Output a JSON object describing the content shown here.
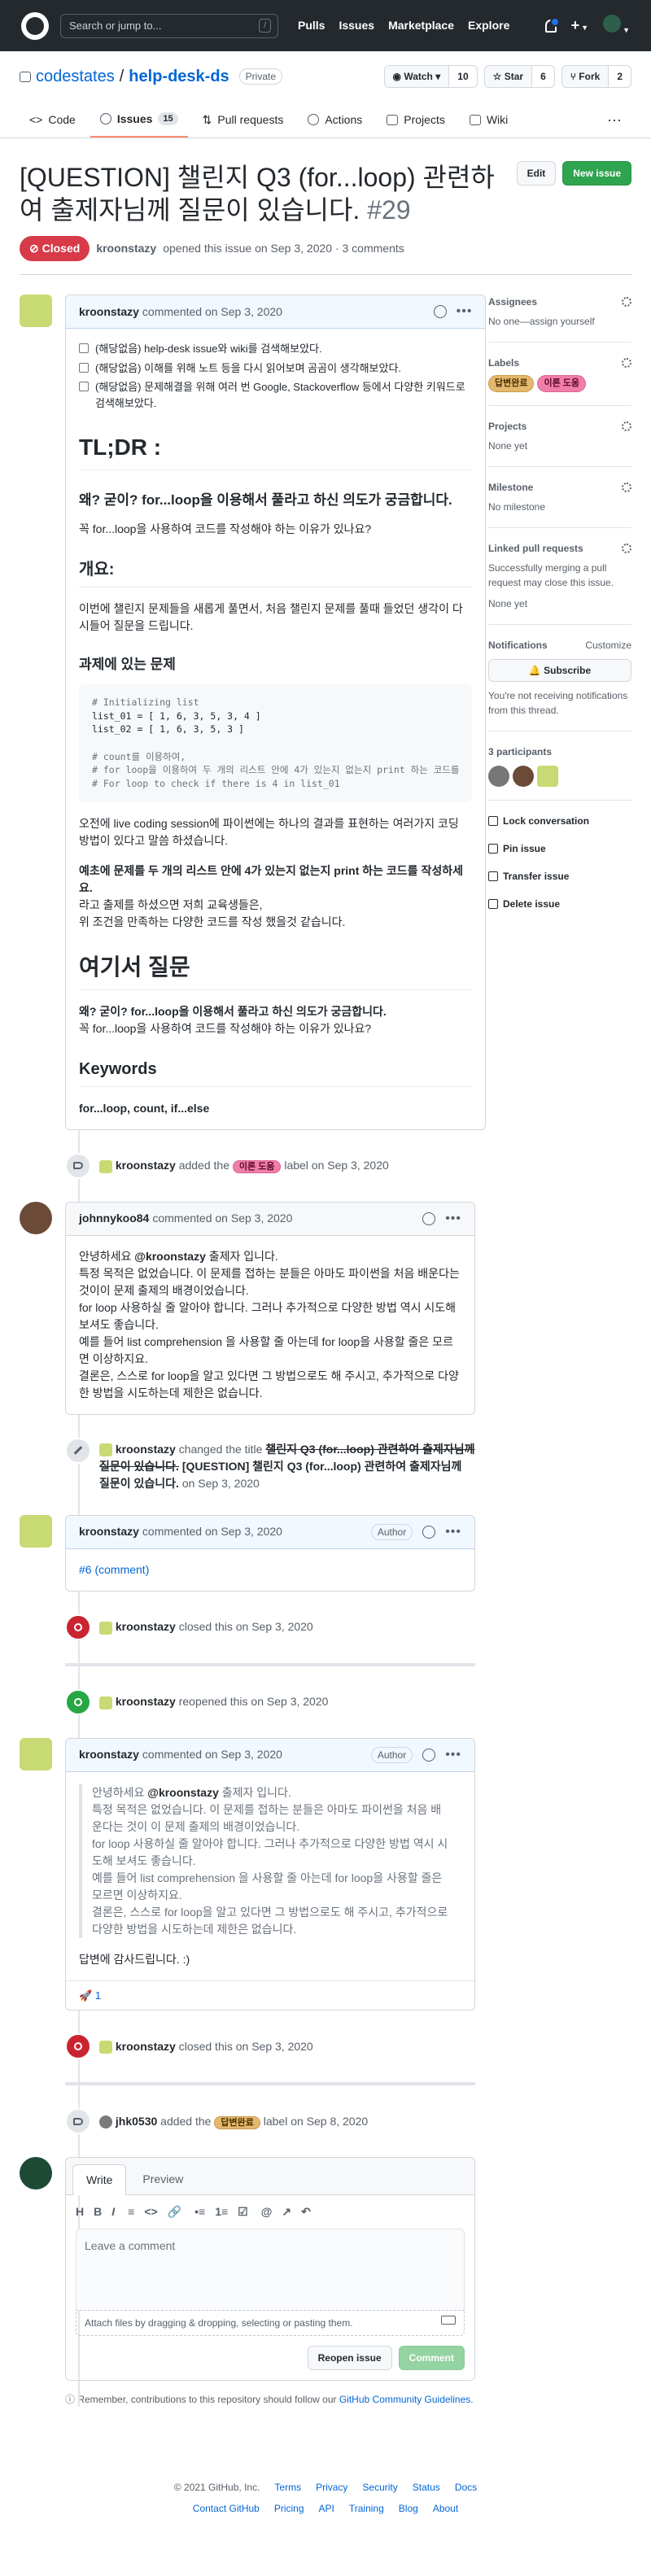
{
  "header": {
    "search_placeholder": "Search or jump to...",
    "slash_key": "/",
    "nav": [
      "Pulls",
      "Issues",
      "Marketplace",
      "Explore"
    ],
    "plus": "+"
  },
  "repo": {
    "owner": "codestates",
    "separator": "/",
    "name": "help-desk-ds",
    "visibility": "Private",
    "watch_label": "Watch",
    "watch_count": "10",
    "star_label": "Star",
    "star_count": "6",
    "fork_label": "Fork",
    "fork_count": "2",
    "tabs": [
      {
        "label": "Code"
      },
      {
        "label": "Issues",
        "count": "15"
      },
      {
        "label": "Pull requests"
      },
      {
        "label": "Actions"
      },
      {
        "label": "Projects"
      },
      {
        "label": "Wiki"
      }
    ],
    "more": "···"
  },
  "issue": {
    "title": "[QUESTION] 챌린지 Q3 (for...loop) 관련하여 출제자님께 질문이 있습니다.",
    "number": "#29",
    "edit_label": "Edit",
    "new_issue_label": "New issue",
    "state": "Closed",
    "author": "kroonstazy",
    "meta": "opened this issue on Sep 3, 2020 · 3 comments"
  },
  "comment1": {
    "author": "kroonstazy",
    "meta": "commented on Sep 3, 2020",
    "tasks": [
      "(해당없음) help-desk issue와 wiki를 검색해보았다.",
      "(해당없음) 이해를 위해 노트 등을 다시 읽어보며 곰곰이 생각해보았다.",
      "(해당없음) 문제해결을 위해 여러 번 Google, Stackoverflow 등에서 다양한 키워드로 검색해보았다."
    ],
    "h_tldr": "TL;DR :",
    "tldr_q": "왜? 굳이? for...loop을 이용해서 풀라고 하신 의도가 궁금합니다.",
    "tldr_p": "꼭 for...loop을 사용하여 코드를 작성해야 하는 이유가 있나요?",
    "h_overview": "개요:",
    "overview_p": "이번에 챌린지 문제들을 새롭게 풀면서, 처음 챌린지 문제를 풀때 들었던 생각이 다시들어 질문을 드립니다.",
    "h_problem": "과제에 있는 문제",
    "code": {
      "c1": "# Initializing list",
      "l1": "list_01 = [ 1, 6, 3, 5, 3, 4 ]",
      "l2": "list_02 = [ 1, 6, 3, 5, 3 ]",
      "c2": "# count를 이용하여,",
      "c3": "# for loop을 이용하여 두 개의 리스트 안에 4가 있는지 없는지 print 하는 코드를",
      "c4": "# For loop to check if there is 4 in list_01"
    },
    "p_live": "오전에 live coding session에 파이썬에는 하나의 결과를 표현하는 여러가지 코딩 방법이 있다고 말씀 하셨습니다.",
    "p_bold": "예초에 문제를 두 개의 리스트 안에 4가 있는지 없는지 print 하는 코드를 작성하세요.",
    "p_line2": "라고 출제를 하셨으면 저희 교육생들은,",
    "p_line3": "위 조건을 만족하는 다양한 코드를 작성 했을것 같습니다.",
    "h_question": "여기서 질문",
    "q_bold": "왜? 굳이? for...loop을 이용해서 풀라고 하신 의도가 궁금합니다.",
    "q_p": "꼭 for...loop을 사용하여 코드를 작성해야 하는 이유가 있나요?",
    "h_keywords": "Keywords",
    "keywords": "for...loop, count, if...else"
  },
  "event_label1": {
    "actor": "kroonstazy",
    "pre": "added the",
    "label": "이론 도움",
    "post": "label on Sep 3, 2020"
  },
  "comment2": {
    "author": "johnnykoo84",
    "meta": "commented on Sep 3, 2020",
    "greet_pre": "안녕하세요",
    "mention": "@kroonstazy",
    "greet_post": "출제자 입니다.",
    "lines": [
      "특정 목적은 없었습니다. 이 문제를 접하는 분들은 아마도 파이썬을 처음 배운다는 것이이 문제 출제의 배경이었습니다.",
      "for loop 사용하실 줄 알아야 합니다. 그러나 추가적으로 다양한 방법 역시 시도해 보셔도 좋습니다.",
      "예를 들어 list comprehension 을 사용할 줄 아는데 for loop을 사용할 줄은 모르면 이상하지요.",
      "결론은, 스스로 for loop을 알고 있다면 그 방법으로도 해 주시고, 추가적으로 다양한 방법을 시도하는데 제한은 없습니다."
    ]
  },
  "event_rename": {
    "actor": "kroonstazy",
    "pre": "changed the title",
    "old_title": "챌린지 Q3 (for...loop) 관련하여 출제자님께 질문이 있습니다.",
    "new_title": "[QUESTION] 챌린지 Q3 (for...loop) 관련하여 출제자님께 질문이 있습니다.",
    "post": "on Sep 3, 2020"
  },
  "comment3": {
    "author": "kroonstazy",
    "meta": "commented on Sep 3, 2020",
    "badge": "Author",
    "link": "#6 (comment)"
  },
  "event_closed1": {
    "actor": "kroonstazy",
    "text": "closed this on Sep 3, 2020"
  },
  "event_reopened": {
    "actor": "kroonstazy",
    "text": "reopened this on Sep 3, 2020"
  },
  "comment4": {
    "author": "kroonstazy",
    "meta": "commented on Sep 3, 2020",
    "badge": "Author",
    "q_greet_pre": "안녕하세요",
    "q_mention": "@kroonstazy",
    "q_greet_post": "출제자 입니다.",
    "q_lines": [
      "특정 목적은 없었습니다. 이 문제를 접하는 분들은 아마도 파이썬을 처음 배운다는 것이 이 문제 출제의 배경이었습니다.",
      "for loop 사용하실 줄 알아야 합니다. 그러나 추가적으로 다양한 방법 역시 시도해 보셔도 좋습니다.",
      "예를 들어 list comprehension 을 사용할 줄 아는데 for loop을 사용할 줄은 모르면 이상하지요.",
      "결론은, 스스로 for loop을 알고 있다면 그 방법으로도 해 주시고, 추가적으로 다양한 방법을 시도하는데 제한은 없습니다."
    ],
    "thanks": "답변에 감사드립니다. :)",
    "reaction_emoji": "🚀",
    "reaction_count": "1"
  },
  "event_closed2": {
    "actor": "kroonstazy",
    "text": "closed this on Sep 3, 2020"
  },
  "event_label2": {
    "actor": "jhk0530",
    "pre": "added the",
    "label": "답변완료",
    "post": "label on Sep 8, 2020"
  },
  "editor": {
    "write_tab": "Write",
    "preview_tab": "Preview",
    "tools_a": [
      "H",
      "B",
      "I"
    ],
    "tools_b": [
      "≡",
      "<>",
      "🔗"
    ],
    "tools_c": [
      "•≡",
      "1≡",
      "☑"
    ],
    "tools_d": [
      "@",
      "↗",
      "↶"
    ],
    "placeholder": "Leave a comment",
    "attach": "Attach files by dragging & dropping, selecting or pasting them.",
    "reopen_label": "Reopen issue",
    "comment_label": "Comment"
  },
  "note": {
    "text": "Remember, contributions to this repository should follow our",
    "link": "GitHub Community Guidelines."
  },
  "sidebar": {
    "assignees_title": "Assignees",
    "assignees_text": "No one—assign yourself",
    "labels_title": "Labels",
    "labels": [
      "답변완료",
      "이론 도움"
    ],
    "projects_title": "Projects",
    "projects_text": "None yet",
    "milestone_title": "Milestone",
    "milestone_text": "No milestone",
    "linked_title": "Linked pull requests",
    "linked_text": "Successfully merging a pull request may close this issue.",
    "linked_none": "None yet",
    "notifications_title": "Notifications",
    "customize": "Customize",
    "subscribe": "Subscribe",
    "notif_text": "You're not receiving notifications from this thread.",
    "participants_title": "3 participants",
    "lock": "Lock conversation",
    "pin": "Pin issue",
    "transfer": "Transfer issue",
    "delete": "Delete issue"
  },
  "footer": {
    "copyright": "© 2021 GitHub, Inc.",
    "row1": [
      "Terms",
      "Privacy",
      "Security",
      "Status",
      "Docs"
    ],
    "row2": [
      "Contact GitHub",
      "Pricing",
      "API",
      "Training",
      "Blog",
      "About"
    ]
  },
  "colors": {
    "closed": "#d73a49",
    "label_pink": "#f17ea8",
    "label_orange": "#e4b96f",
    "primary_green": "#2ea44f",
    "link": "#0366d6"
  }
}
